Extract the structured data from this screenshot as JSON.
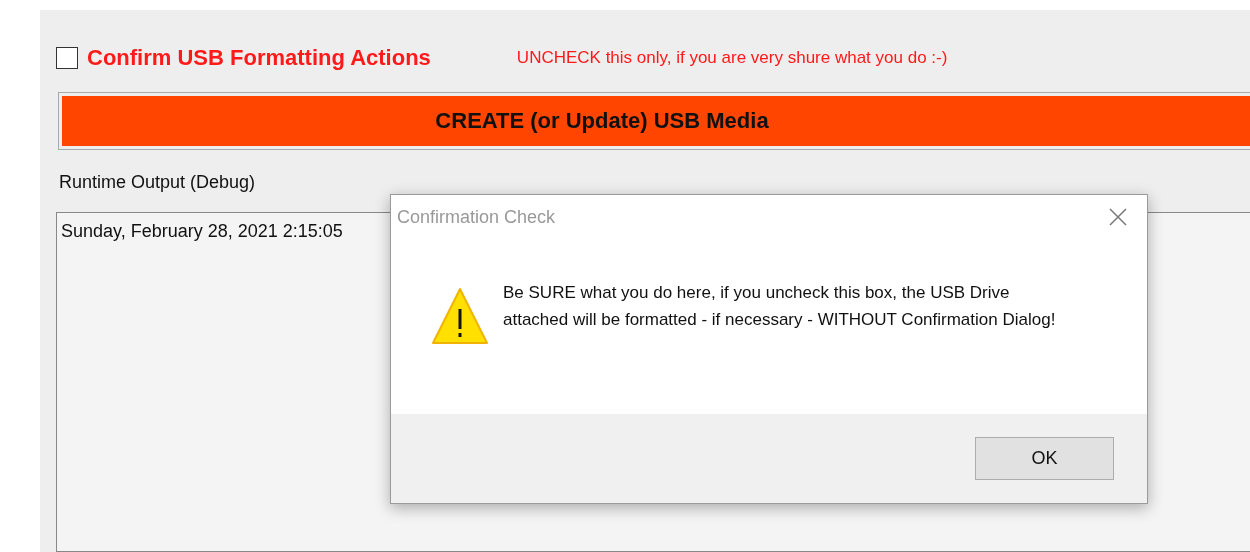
{
  "confirm_checkbox": {
    "label": "Confirm USB Formatting Actions",
    "checked": false
  },
  "hint": "UNCHECK this only, if you are very shure what you do :-)",
  "create_button": {
    "label": "CREATE (or Update) USB Media"
  },
  "output": {
    "label": "Runtime Output (Debug)",
    "lines": [
      "Sunday, February 28, 2021 2:15:05"
    ]
  },
  "dialog": {
    "title": "Confirmation Check",
    "message": "Be SURE what you do here, if you uncheck this box, the USB Drive attached will be formatted - if necessary - WITHOUT Confirmation Dialog!",
    "buttons": [
      "OK"
    ]
  }
}
